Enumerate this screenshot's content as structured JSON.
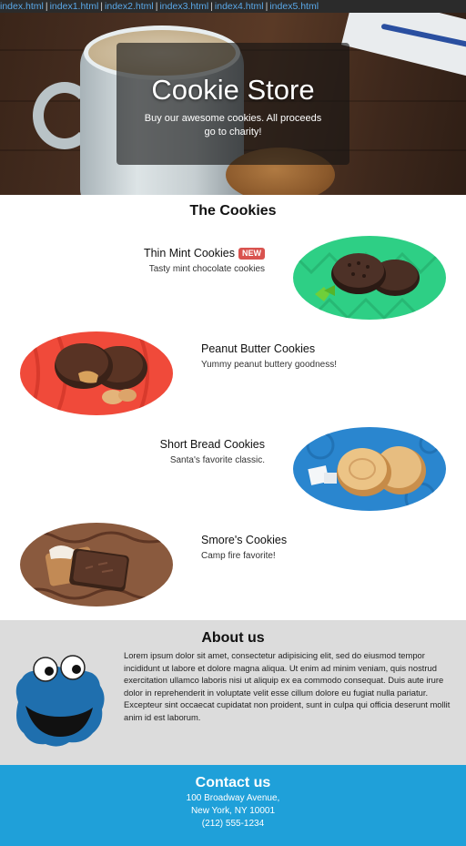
{
  "nav": {
    "links": [
      "index.html",
      "index1.html",
      "index2.html",
      "index3.html",
      "index4.html",
      "index5.html"
    ],
    "separator": "|",
    "link_color": "#5aa8e8"
  },
  "hero": {
    "title": "Cookie Store",
    "subtitle": "Buy our awesome cookies. All proceeds go to charity!"
  },
  "cookies": {
    "heading": "The Cookies",
    "items": [
      {
        "name": "Thin Mint Cookies",
        "badge": "NEW",
        "description": "Tasty mint chocolate cookies",
        "image_bg": "#2ecf85"
      },
      {
        "name": "Peanut Butter Cookies",
        "description": "Yummy peanut buttery goodness!",
        "image_bg": "#f04a3a"
      },
      {
        "name": "Short Bread Cookies",
        "description": "Santa's favorite classic.",
        "image_bg": "#2a86cf"
      },
      {
        "name": "Smore's Cookies",
        "description": "Camp fire favorite!",
        "image_bg": "#8a5a3e"
      }
    ]
  },
  "about": {
    "heading": "About us",
    "text": "Lorem ipsum dolor sit amet, consectetur adipisicing elit, sed do eiusmod tempor incididunt ut labore et dolore magna aliqua. Ut enim ad minim veniam, quis nostrud exercitation ullamco laboris nisi ut aliquip ex ea commodo consequat. Duis aute irure dolor in reprehenderit in voluptate velit esse cillum dolore eu fugiat nulla pariatur. Excepteur sint occaecat cupidatat non proident, sunt in culpa qui officia deserunt mollit anim id est laborum."
  },
  "contact": {
    "heading": "Contact us",
    "address_line1": "100 Broadway Avenue,",
    "address_line2": "New York, NY 10001",
    "phone": "(212) 555-1234",
    "background": "#1fa0d9"
  }
}
